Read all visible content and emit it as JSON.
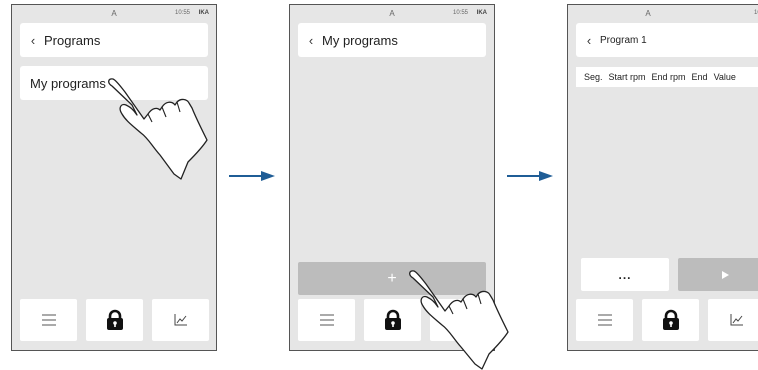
{
  "status": {
    "label": "A",
    "time": "10:55",
    "brand": "IKA"
  },
  "screen1": {
    "title": "Programs",
    "item": "My programs"
  },
  "screen2": {
    "title": "My programs",
    "add_label": "+"
  },
  "screen3": {
    "title": "Program 1",
    "columns": [
      "Seg.",
      "Start rpm",
      "End rpm",
      "End",
      "Value"
    ],
    "more_label": "..."
  },
  "icons": {
    "back": "chevron-left-icon",
    "menu": "menu-icon",
    "lock": "lock-icon",
    "graph": "graph-icon",
    "play": "play-icon",
    "hand": "pointing-hand-icon",
    "arrow": "arrow-right-icon"
  },
  "colors": {
    "arrow": "#1f5d96",
    "bar_disabled": "#bcbcbc",
    "screen_bg": "#e6e6e6"
  }
}
